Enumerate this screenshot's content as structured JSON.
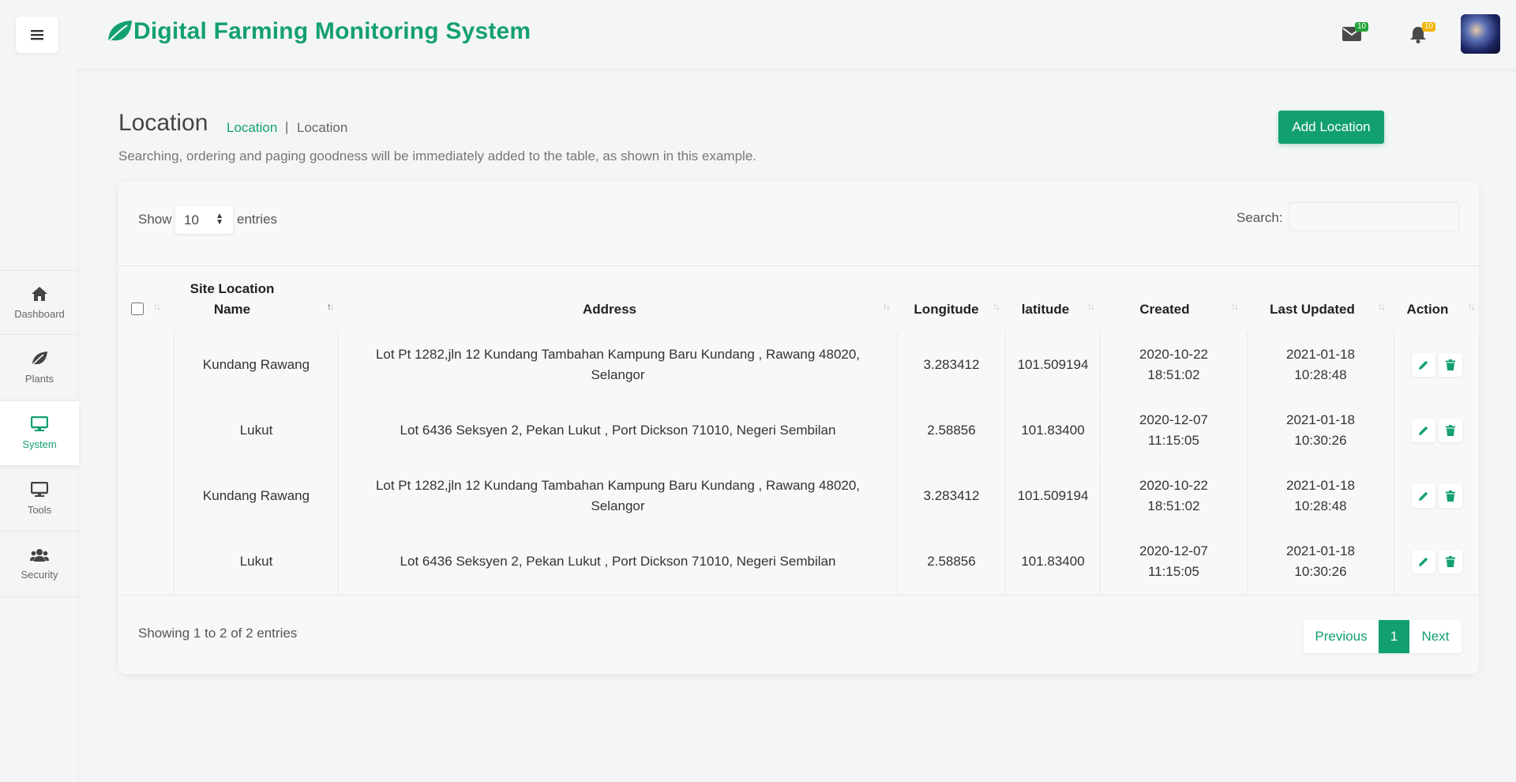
{
  "app": {
    "title": "Digital Farming Monitoring System"
  },
  "header": {
    "mail_badge": "10",
    "bell_badge": "10",
    "colors": {
      "accent": "#13a06f",
      "mail_badge": "#22a33a",
      "bell_badge": "#f0b400"
    }
  },
  "sidebar": {
    "items": [
      {
        "label": "Dashboard",
        "icon": "home-icon"
      },
      {
        "label": "Plants",
        "icon": "leaf-icon"
      },
      {
        "label": "System",
        "icon": "monitor-icon",
        "active": true
      },
      {
        "label": "Tools",
        "icon": "monitor-icon"
      },
      {
        "label": "Security",
        "icon": "users-icon"
      }
    ]
  },
  "page": {
    "title": "Location",
    "breadcrumb": [
      "Location",
      "Location"
    ],
    "breadcrumb_sep": "|",
    "description": "Searching, ordering and paging goodness will be immediately added to the table, as shown in this example.",
    "add_button": "Add Location"
  },
  "table_controls": {
    "show_label": "Show",
    "page_size": "10",
    "entries_label": "entries",
    "search_label": "Search:",
    "search_value": ""
  },
  "table": {
    "columns": [
      "Site Location Name",
      "Address",
      "Longitude",
      "latitude",
      "Created",
      "Last Updated",
      "Action"
    ],
    "column_lines": [
      [
        "Site Location",
        "Name"
      ]
    ],
    "rows": [
      {
        "name": "Kundang Rawang",
        "address": "Lot Pt 1282,jln 12 Kundang Tambahan Kampung Baru Kundang , Rawang 48020, Selangor",
        "longitude": "3.283412",
        "latitude": "101.509194",
        "created": [
          "2020-10-22",
          "18:51:02"
        ],
        "updated": [
          "2021-01-18",
          "10:28:48"
        ]
      },
      {
        "name": "Lukut",
        "address": "Lot 6436 Seksyen 2, Pekan Lukut , Port Dickson 71010, Negeri Sembilan",
        "longitude": "2.58856",
        "latitude": "101.83400",
        "created": [
          "2020-12-07",
          "11:15:05"
        ],
        "updated": [
          "2021-01-18",
          "10:30:26"
        ]
      },
      {
        "name": "Kundang Rawang",
        "address": "Lot Pt 1282,jln 12 Kundang Tambahan Kampung Baru Kundang , Rawang 48020, Selangor",
        "longitude": "3.283412",
        "latitude": "101.509194",
        "created": [
          "2020-10-22",
          "18:51:02"
        ],
        "updated": [
          "2021-01-18",
          "10:28:48"
        ]
      },
      {
        "name": "Lukut",
        "address": "Lot 6436 Seksyen 2, Pekan Lukut , Port Dickson 71010, Negeri Sembilan",
        "longitude": "2.58856",
        "latitude": "101.83400",
        "created": [
          "2020-12-07",
          "11:15:05"
        ],
        "updated": [
          "2021-01-18",
          "10:30:26"
        ]
      }
    ]
  },
  "footer": {
    "info": "Showing 1 to 2 of 2 entries",
    "previous": "Previous",
    "current_page": "1",
    "next": "Next"
  }
}
